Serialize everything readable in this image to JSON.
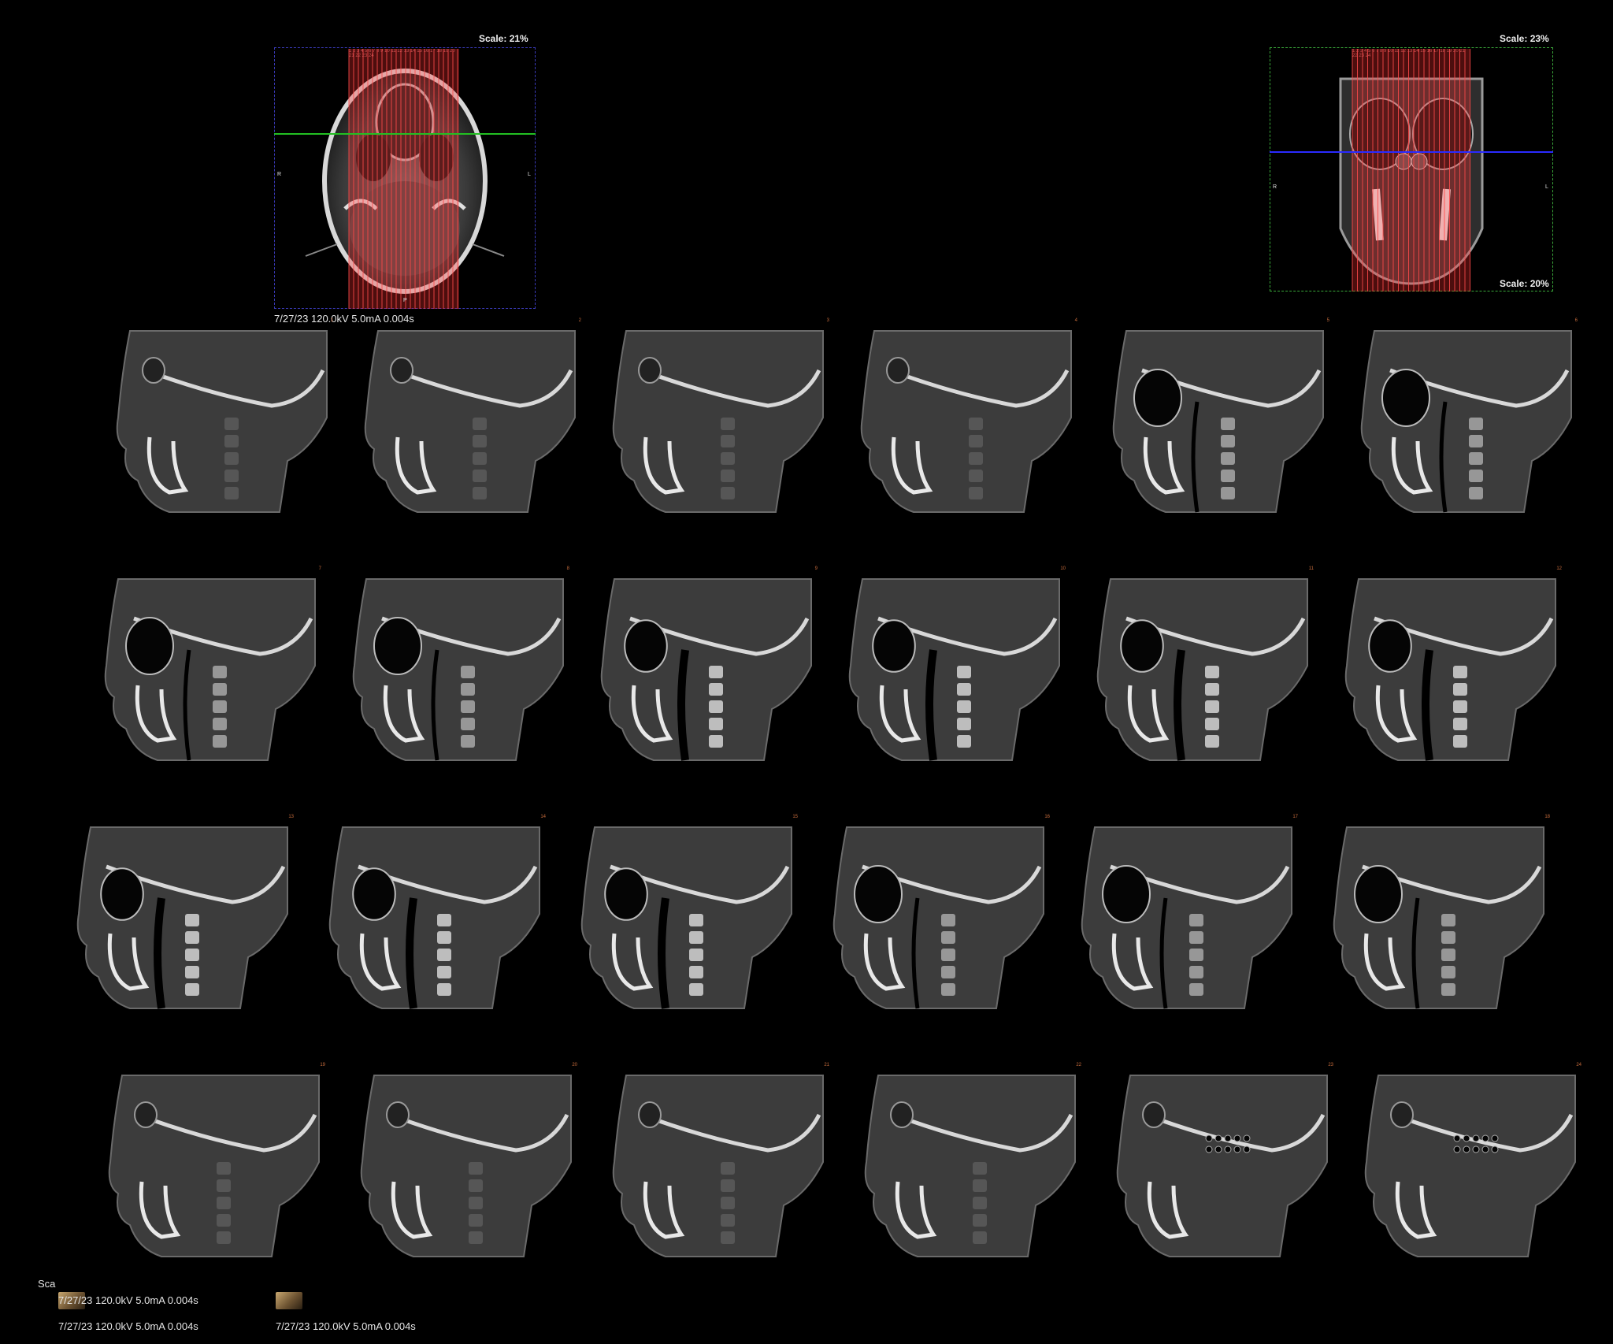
{
  "axial_scout": {
    "scale": "Scale: 21%",
    "orientation": {
      "right": "R",
      "left": "L",
      "posterior": "P"
    },
    "slice_numbers": "1 2 3 4 5 6 7 8 9 10 11 12 13 14 15 16 17 18 19 20 21 22 23 24"
  },
  "coronal_scout": {
    "scale_top": "Scale: 23%",
    "scale_bottom": "Scale: 20%",
    "orientation": {
      "right": "R",
      "left": "L"
    },
    "slice_numbers": "1 2 3 4 5 6 7 8 9 10 11 12 13 14 15 16 17 18 19 20 21 22 23 24"
  },
  "acquisition_info": "7/27/23 120.0kV 5.0mA 0.004s",
  "slices": [
    {
      "n": "1",
      "view": "lateral"
    },
    {
      "n": "2",
      "view": "lateral"
    },
    {
      "n": "3",
      "view": "lateral"
    },
    {
      "n": "4",
      "view": "lateral"
    },
    {
      "n": "5",
      "view": "sinus"
    },
    {
      "n": "6",
      "view": "sinus"
    },
    {
      "n": "7",
      "view": "sinus"
    },
    {
      "n": "8",
      "view": "sinus"
    },
    {
      "n": "9",
      "view": "mid"
    },
    {
      "n": "10",
      "view": "mid"
    },
    {
      "n": "11",
      "view": "mid"
    },
    {
      "n": "12",
      "view": "mid"
    },
    {
      "n": "13",
      "view": "mid"
    },
    {
      "n": "14",
      "view": "mid"
    },
    {
      "n": "15",
      "view": "mid"
    },
    {
      "n": "16",
      "view": "sinus"
    },
    {
      "n": "17",
      "view": "sinus"
    },
    {
      "n": "18",
      "view": "sinus"
    },
    {
      "n": "19",
      "view": "lateral"
    },
    {
      "n": "20",
      "view": "lateral"
    },
    {
      "n": "21",
      "view": "lateral"
    },
    {
      "n": "22",
      "view": "lateral"
    },
    {
      "n": "23",
      "view": "mastoid"
    },
    {
      "n": "24",
      "view": "mastoid"
    }
  ],
  "footer": {
    "partial_label": "Sca",
    "items": [
      {
        "label": "7/27/23 120.0kV 5.0mA 0.004s",
        "icon": "scan-thumbnail-icon"
      },
      {
        "label": "7/27/23 120.0kV 5.0mA 0.004s",
        "icon": ""
      },
      {
        "label": "7/27/23 120.0kV 5.0mA 0.004s",
        "icon": "scan-thumbnail-icon"
      }
    ]
  },
  "colors": {
    "background": "#000000",
    "slice_line": "#ff4a4a",
    "axial_frame": "#3a3ab8",
    "coronal_frame": "#3aa83a",
    "axial_cut": "#22c022",
    "coronal_cut": "#2a2aff"
  }
}
